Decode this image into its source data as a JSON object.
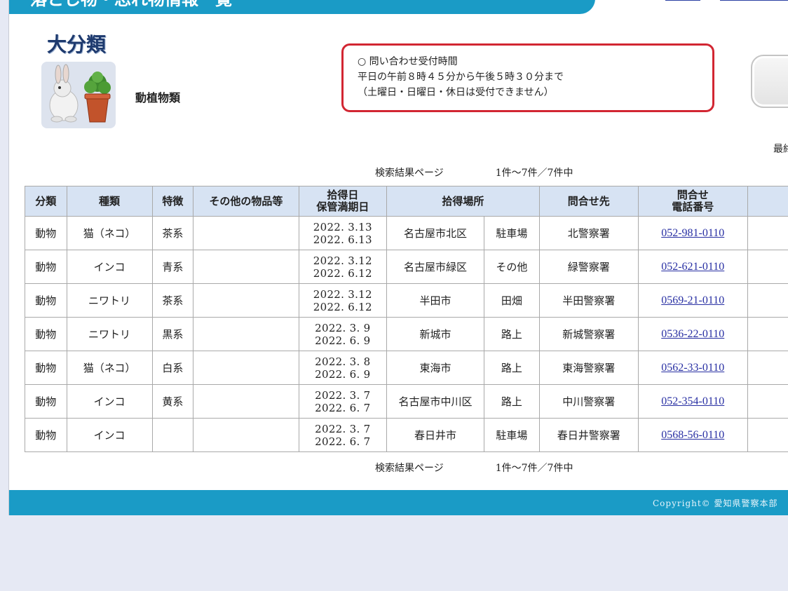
{
  "page_title": "落とし物・忘れ物情報一覧",
  "category": {
    "heading": "大分類",
    "image_alt": "rabbit-and-potted-plant",
    "label": "動植物類"
  },
  "notice": {
    "line1": "○ 問い合わせ受付時間",
    "line2": "平日の午前８時４５分から午後５時３０分まで",
    "line3": "（土曜日・日曜日・休日は受付できません）"
  },
  "last_updated_label": "最終",
  "pager": {
    "label": "検索結果ページ",
    "count": "1件〜7件／7件中"
  },
  "table": {
    "headers": {
      "category": "分類",
      "type": "種類",
      "feature": "特徴",
      "other_items": "その他の物品等",
      "date_line1": "拾得日",
      "date_line2": "保管満期日",
      "place": "拾得場所",
      "contact": "問合せ先",
      "phone_line1": "問合せ",
      "phone_line2": "電話番号"
    },
    "rows": [
      {
        "category": "動物",
        "type": "猫（ネコ）",
        "feature": "茶系",
        "other": "",
        "found_date": "2022. 3.13",
        "expiry_date": "2022. 6.13",
        "place_city": "名古屋市北区",
        "place_detail": "駐車場",
        "contact": "北警察署",
        "phone": "052-981-0110"
      },
      {
        "category": "動物",
        "type": "インコ",
        "feature": "青系",
        "other": "",
        "found_date": "2022. 3.12",
        "expiry_date": "2022. 6.12",
        "place_city": "名古屋市緑区",
        "place_detail": "その他",
        "contact": "緑警察署",
        "phone": "052-621-0110"
      },
      {
        "category": "動物",
        "type": "ニワトリ",
        "feature": "茶系",
        "other": "",
        "found_date": "2022. 3.12",
        "expiry_date": "2022. 6.12",
        "place_city": "半田市",
        "place_detail": "田畑",
        "contact": "半田警察署",
        "phone": "0569-21-0110"
      },
      {
        "category": "動物",
        "type": "ニワトリ",
        "feature": "黒系",
        "other": "",
        "found_date": "2022. 3. 9",
        "expiry_date": "2022. 6. 9",
        "place_city": "新城市",
        "place_detail": "路上",
        "contact": "新城警察署",
        "phone": "0536-22-0110"
      },
      {
        "category": "動物",
        "type": "猫（ネコ）",
        "feature": "白系",
        "other": "",
        "found_date": "2022. 3. 8",
        "expiry_date": "2022. 6. 9",
        "place_city": "東海市",
        "place_detail": "路上",
        "contact": "東海警察署",
        "phone": "0562-33-0110"
      },
      {
        "category": "動物",
        "type": "インコ",
        "feature": "黄系",
        "other": "",
        "found_date": "2022. 3. 7",
        "expiry_date": "2022. 6. 7",
        "place_city": "名古屋市中川区",
        "place_detail": "路上",
        "contact": "中川警察署",
        "phone": "052-354-0110"
      },
      {
        "category": "動物",
        "type": "インコ",
        "feature": "",
        "other": "",
        "found_date": "2022. 3. 7",
        "expiry_date": "2022. 6. 7",
        "place_city": "春日井市",
        "place_detail": "駐車場",
        "contact": "春日井警察署",
        "phone": "0568-56-0110"
      }
    ]
  },
  "footer": {
    "copyright": "Copyright© 愛知県警察本部"
  },
  "colors": {
    "brand": "#1a9bc6",
    "header_cell": "#d7e3f3",
    "notice_border": "#d22632",
    "link": "#2930a3"
  }
}
